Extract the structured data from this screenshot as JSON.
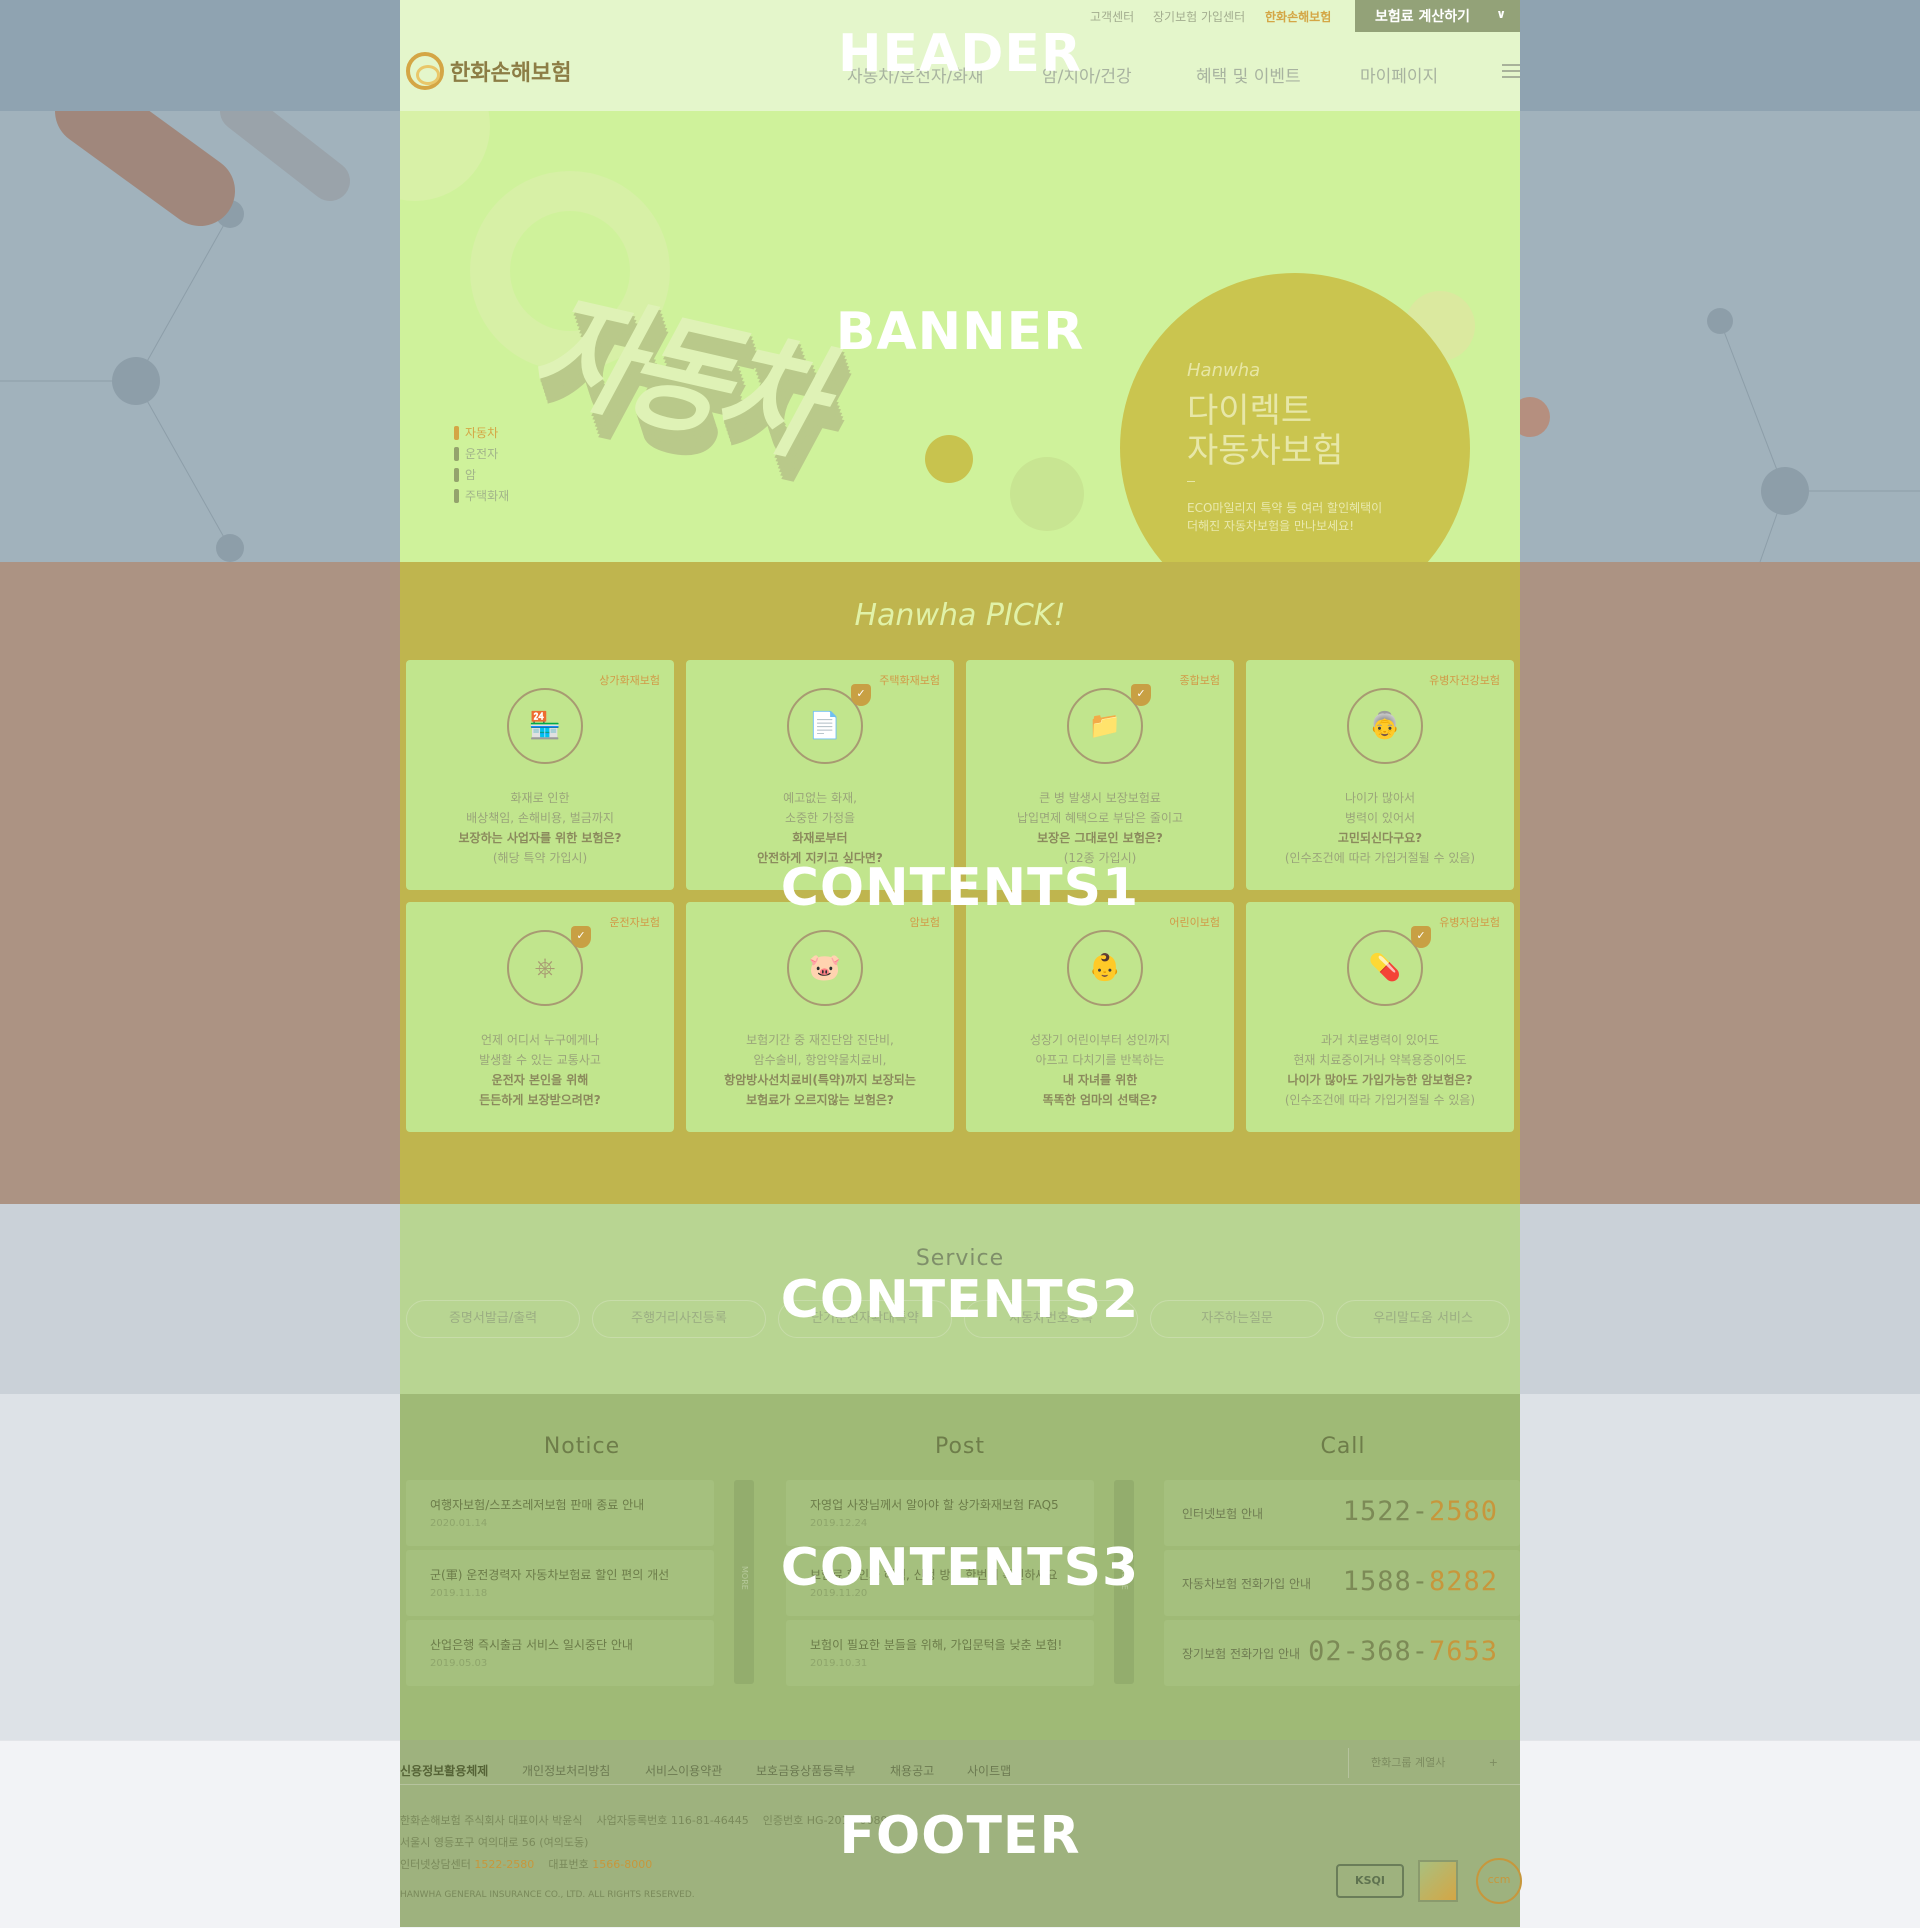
{
  "section_labels": {
    "header": "HEADER",
    "banner": "BANNER",
    "contents1": "CONTENTS1",
    "contents2": "CONTENTS2",
    "contents3": "CONTENTS3",
    "footer": "FOOTER"
  },
  "header": {
    "util_links": [
      "고객센터",
      "장기보험 가입센터",
      "한화손해보험"
    ],
    "calc_button": "보험료 계산하기",
    "logo_text": "한화손해보험",
    "gnb": [
      "자동차/운전자/화재",
      "암/치아/건강",
      "혜택 및 이벤트",
      "마이페이지"
    ]
  },
  "banner": {
    "big_text": "자동차",
    "nav": [
      "자동차",
      "운전자",
      "암",
      "주택화재"
    ],
    "promo": {
      "brand": "Hanwha",
      "title_line1": "다이렉트",
      "title_line2": "자동차보험",
      "desc_line1": "ECO마일리지 특약 등 여러 할인혜택이",
      "desc_line2": "더해진 자동차보험을 만나보세요!"
    }
  },
  "contents1": {
    "title": "Hanwha PICK!",
    "cards": [
      {
        "tag": "상가화재보험",
        "icon": "shop-fire-icon",
        "glyph": "🏪",
        "lines": [
          "화재로 인한",
          "배상책임, 손해비용, 벌금까지"
        ],
        "strong": [
          "보장하는 사업자를 위한 보험은?"
        ],
        "note": "(해당 특약 가입시)"
      },
      {
        "tag": "주택화재보험",
        "icon": "house-document-icon",
        "glyph": "📄",
        "lines": [
          "예고없는 화재,",
          "소중한 가정을"
        ],
        "strong": [
          "화재로부터",
          "안전하게 지키고 싶다면?"
        ],
        "note": ""
      },
      {
        "tag": "종합보험",
        "icon": "folder-icon",
        "glyph": "📁",
        "lines": [
          "큰 병 발생시 보장보험료",
          "납입면제 혜택으로 부담은 줄이고"
        ],
        "strong": [
          "보장은 그대로인 보험은?"
        ],
        "note": "(12종 가입시)"
      },
      {
        "tag": "유병자건강보험",
        "icon": "elderly-couple-icon",
        "glyph": "👵",
        "lines": [
          "나이가 많아서",
          "병력이 있어서"
        ],
        "strong": [
          "고민되신다구요?"
        ],
        "note": "(인수조건에 따라 가입거절될 수 있음)"
      },
      {
        "tag": "운전자보험",
        "icon": "steering-wheel-icon",
        "glyph": "⎈",
        "lines": [
          "언제 어디서 누구에게나",
          "발생할 수 있는 교통사고"
        ],
        "strong": [
          "운전자 본인을 위해",
          "든든하게 보장받으려면?"
        ],
        "note": ""
      },
      {
        "tag": "암보험",
        "icon": "piggy-bank-icon",
        "glyph": "🐷",
        "lines": [
          "보험기간 중 재진단암 진단비,",
          "암수술비, 항암약물치료비,"
        ],
        "strong": [
          "항암방사선치료비(특약)까지 보장되는",
          "보험료가 오르지않는 보험은?"
        ],
        "note": ""
      },
      {
        "tag": "어린이보험",
        "icon": "baby-face-icon",
        "glyph": "👶",
        "lines": [
          "성장기 어린이부터 성인까지",
          "아프고 다치기를 반복하는"
        ],
        "strong": [
          "내 자녀를 위한",
          "똑똑한 엄마의 선택은?"
        ],
        "note": ""
      },
      {
        "tag": "유병자암보험",
        "icon": "pill-icon",
        "glyph": "💊",
        "lines": [
          "과거 치료병력이 있어도",
          "현재 치료중이거나 약복용중이어도"
        ],
        "strong": [
          "나이가 많아도 가입가능한 암보험은?"
        ],
        "note": "(인수조건에 따라 가입거절될 수 있음)"
      }
    ]
  },
  "contents2": {
    "title": "Service",
    "services": [
      "증명서발급/출력",
      "주행거리사진등록",
      "단기운전자확대특약",
      "자동차번호등록",
      "자주하는질문",
      "우리말도움 서비스"
    ]
  },
  "contents3": {
    "notice": {
      "title": "Notice",
      "more": "MORE",
      "items": [
        {
          "title": "여행자보험/스포츠레저보험 판매 종료 안내",
          "date": "2020.01.14"
        },
        {
          "title": "군(軍) 운전경력자 자동차보험료 할인 편의 개선",
          "date": "2019.11.18"
        },
        {
          "title": "산업은행 즉시출금 서비스 일시중단 안내",
          "date": "2019.05.03"
        }
      ]
    },
    "post": {
      "title": "Post",
      "more": "MORE",
      "items": [
        {
          "title": "자영업 사장님께서 알아야 할 상가화재보험 FAQ5",
          "date": "2019.12.24"
        },
        {
          "title": "보험료 할인과 혜택, 신청 방법 한번에 확인하세요",
          "date": "2019.11.20"
        },
        {
          "title": "보험이 필요한 분들을 위해, 가입문턱을 낮춘 보험!",
          "date": "2019.10.31"
        }
      ]
    },
    "call": {
      "title": "Call",
      "rows": [
        {
          "label": "인터넷보험 안내",
          "num_a": "1522-",
          "num_b": "2580"
        },
        {
          "label": "자동차보험 전화가입 안내",
          "num_a": "1588-",
          "num_b": "8282"
        },
        {
          "label": "장기보험 전화가입 안내",
          "num_a": "02-368-",
          "num_b": "7653"
        }
      ]
    }
  },
  "footer": {
    "links": [
      "신용정보활용체제",
      "개인정보처리방침",
      "서비스이용약관",
      "보호금융상품등록부",
      "채용공고",
      "사이트맵"
    ],
    "family_site": "한화그룹 계열사",
    "family_plus": "+",
    "company_line": "한화손해보험 주식회사 대표이사 박윤식",
    "biz_no": "사업자등록번호 116-81-46445",
    "cert_no": "인증번호 HG-2019-0089",
    "address": "서울시 영등포구 여의대로 56 (여의도동)",
    "internet_center_label": "인터넷상담센터",
    "internet_center_num": "1522-2580",
    "main_num_label": "대표번호",
    "main_num": "1566-8000",
    "copyright": "HANWHA GENERAL INSURANCE CO., LTD. ALL RIGHTS RESERVED.",
    "marks": [
      "KSQI",
      "ccm"
    ]
  }
}
